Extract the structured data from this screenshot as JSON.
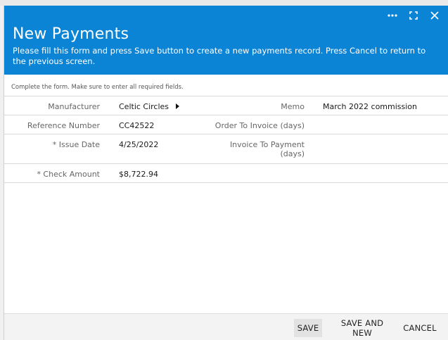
{
  "dialog": {
    "title": "New Payments",
    "subtitle": "Please fill this form and press Save button to create a new payments record. Press Cancel to return to the previous screen.",
    "hint": "Complete the form. Make sure to enter all required fields.",
    "controls": {
      "more_icon": "ellipsis-icon",
      "expand_icon": "expand-icon",
      "close_icon": "close-icon"
    }
  },
  "form": {
    "manufacturer": {
      "label": "Manufacturer",
      "value": "Celtic Circles"
    },
    "memo": {
      "label": "Memo",
      "value": "March 2022 commission"
    },
    "reference_number": {
      "label": "Reference Number",
      "value": "CC42522"
    },
    "order_to_invoice": {
      "label": "Order To Invoice (days)",
      "value": ""
    },
    "issue_date": {
      "label": "* Issue Date",
      "value": "4/25/2022"
    },
    "invoice_to_payment": {
      "label": "Invoice To Payment (days)",
      "value": ""
    },
    "check_amount": {
      "label": "* Check Amount",
      "value": "$8,722.94"
    }
  },
  "footer": {
    "save_label": "SAVE",
    "save_new_label": "SAVE AND NEW",
    "cancel_label": "CANCEL"
  },
  "colors": {
    "header_bg": "#0b84d6",
    "header_text": "#ffffff"
  }
}
